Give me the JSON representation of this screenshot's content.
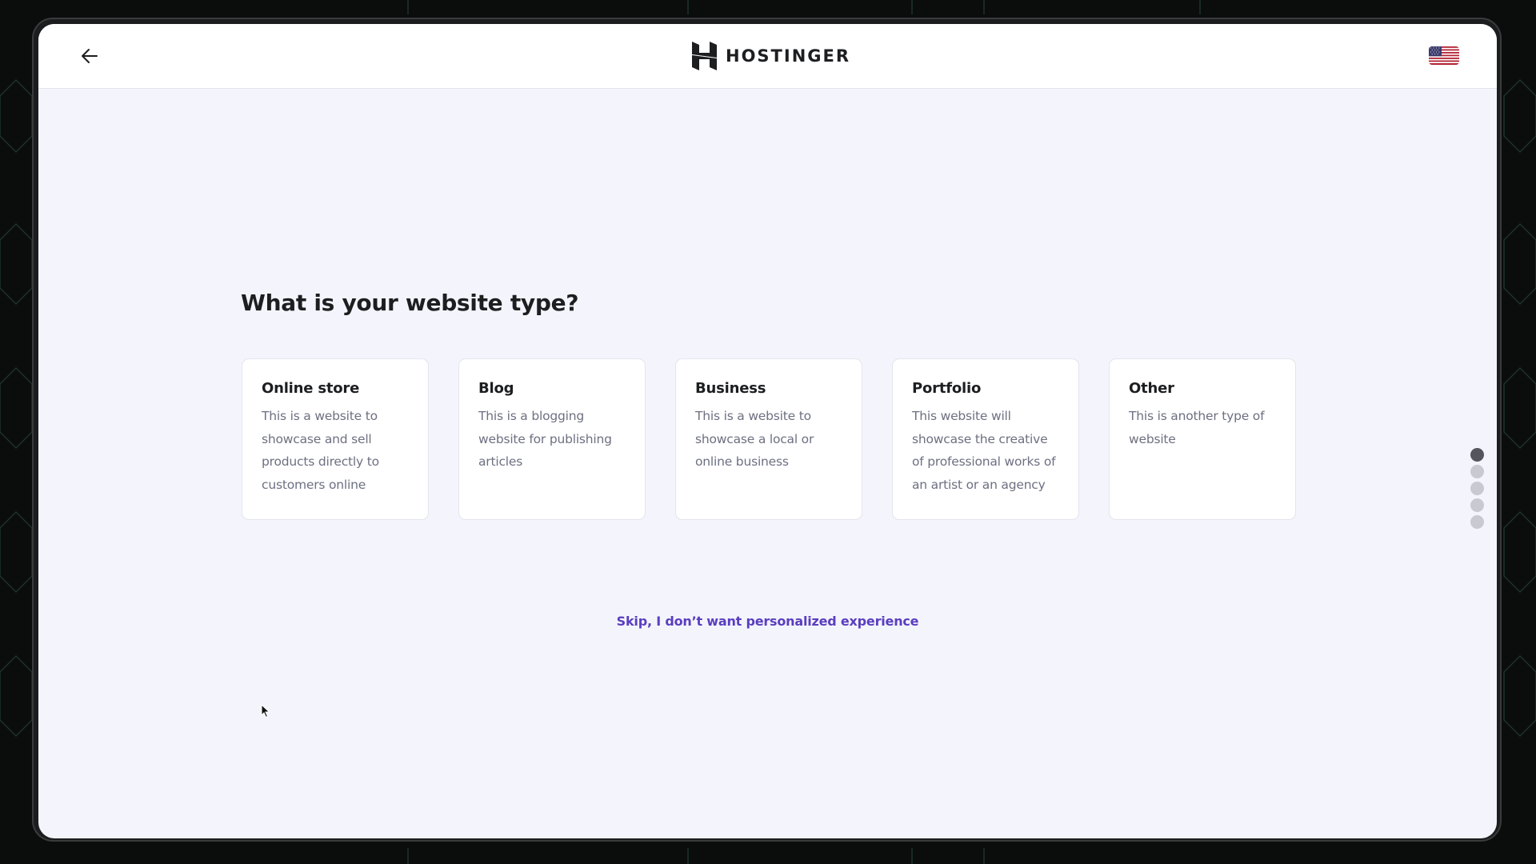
{
  "header": {
    "back_label": "Back",
    "brand_name": "HOSTINGER",
    "language_flag": "us-flag-icon"
  },
  "main": {
    "title": "What is your website type?",
    "cards": [
      {
        "title": "Online store",
        "description": "This is a website to showcase and sell products directly to customers online"
      },
      {
        "title": "Blog",
        "description": "This is a blogging website for publishing articles"
      },
      {
        "title": "Business",
        "description": "This is a website to showcase a local or online business"
      },
      {
        "title": "Portfolio",
        "description": "This website will showcase the creative of professional works of an artist or an agency"
      },
      {
        "title": "Other",
        "description": "This is another type of website"
      }
    ],
    "skip_link": "Skip, I don’t want personalized experience"
  },
  "progress": {
    "total_steps": 5,
    "current_step": 1
  },
  "colors": {
    "accent": "#5a3ec0",
    "background": "#f4f5fc",
    "card": "#ffffff",
    "active_dot": "#55565d",
    "inactive_dot": "#c9cad1"
  }
}
